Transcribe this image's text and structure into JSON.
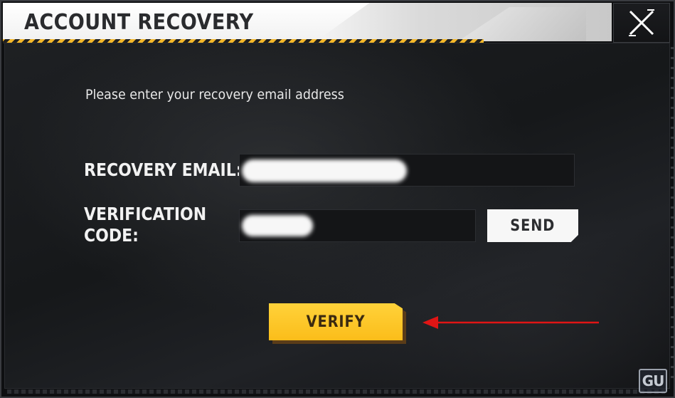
{
  "dialog": {
    "title": "ACCOUNT RECOVERY",
    "close_icon": "close-x-icon"
  },
  "form": {
    "prompt": "Please enter your recovery email address",
    "email_label": "RECOVERY EMAIL:",
    "email_value": "",
    "code_label_line1": "VERIFICATION",
    "code_label_line2": "CODE:",
    "code_value": "",
    "send_label": "SEND",
    "verify_label": "VERIFY"
  },
  "annotation": {
    "arrow_color": "#e01515"
  },
  "watermark": {
    "text": "GU"
  },
  "colors": {
    "accent": "#fbbd1a",
    "header_bg": "#ffffff",
    "panel_bg": "#1b1d20"
  }
}
